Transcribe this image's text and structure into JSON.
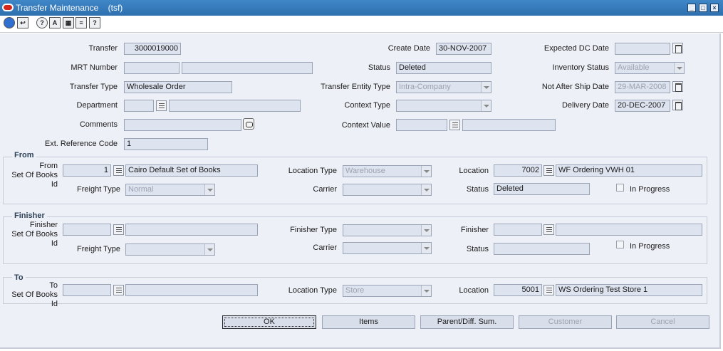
{
  "window": {
    "title": "Transfer Maintenance",
    "subtitle": "(tsf)"
  },
  "toolbar": {
    "icons": [
      "globe-icon",
      "exit-icon",
      "help-icon",
      "spellcheck-icon",
      "calendar-icon",
      "print-icon",
      "context-help-icon"
    ]
  },
  "header": {
    "transfer": {
      "label": "Transfer",
      "value": "3000019000"
    },
    "create_date": {
      "label": "Create Date",
      "value": "30-NOV-2007"
    },
    "expected_dc_date": {
      "label": "Expected DC Date",
      "value": ""
    },
    "mrt_number": {
      "label": "MRT Number",
      "value": ""
    },
    "status": {
      "label": "Status",
      "value": "Deleted"
    },
    "inventory_status": {
      "label": "Inventory Status",
      "value": "Available"
    },
    "transfer_type": {
      "label": "Transfer Type",
      "value": "Wholesale Order"
    },
    "transfer_entity_type": {
      "label": "Transfer Entity Type",
      "value": "Intra-Company"
    },
    "not_after_ship_date": {
      "label": "Not After Ship Date",
      "value": "29-MAR-2008"
    },
    "department": {
      "label": "Department",
      "value": ""
    },
    "context_type": {
      "label": "Context Type",
      "value": ""
    },
    "delivery_date": {
      "label": "Delivery Date",
      "value": "20-DEC-2007"
    },
    "comments": {
      "label": "Comments",
      "value": ""
    },
    "context_value": {
      "label": "Context Value",
      "value": ""
    },
    "ext_reference_code": {
      "label": "Ext. Reference Code",
      "value": "1"
    }
  },
  "from": {
    "title": "From",
    "sob_label_1": "From",
    "sob_label_2": "Set Of Books Id",
    "sob_id": "1",
    "sob_name": "Cairo Default Set of Books",
    "location_type_label": "Location Type",
    "location_type": "Warehouse",
    "location_label": "Location",
    "location_id": "7002",
    "location_name": "WF Ordering VWH 01",
    "freight_type_label": "Freight Type",
    "freight_type": "Normal",
    "carrier_label": "Carrier",
    "carrier": "",
    "status_label": "Status",
    "status": "Deleted",
    "in_progress_label": "In Progress"
  },
  "finisher": {
    "title": "Finisher",
    "sob_label_1": "Finisher",
    "sob_label_2": "Set Of Books Id",
    "finisher_type_label": "Finisher Type",
    "finisher_label": "Finisher",
    "freight_type_label": "Freight Type",
    "carrier_label": "Carrier",
    "status_label": "Status",
    "in_progress_label": "In Progress"
  },
  "to": {
    "title": "To",
    "sob_label_1": "To",
    "sob_label_2": "Set Of Books Id",
    "location_type_label": "Location Type",
    "location_type": "Store",
    "location_label": "Location",
    "location_id": "5001",
    "location_name": "WS Ordering Test Store 1"
  },
  "buttons": {
    "ok": "OK",
    "items": "Items",
    "parent_diff_sum": "Parent/Diff. Sum.",
    "customer": "Customer",
    "cancel": "Cancel"
  }
}
